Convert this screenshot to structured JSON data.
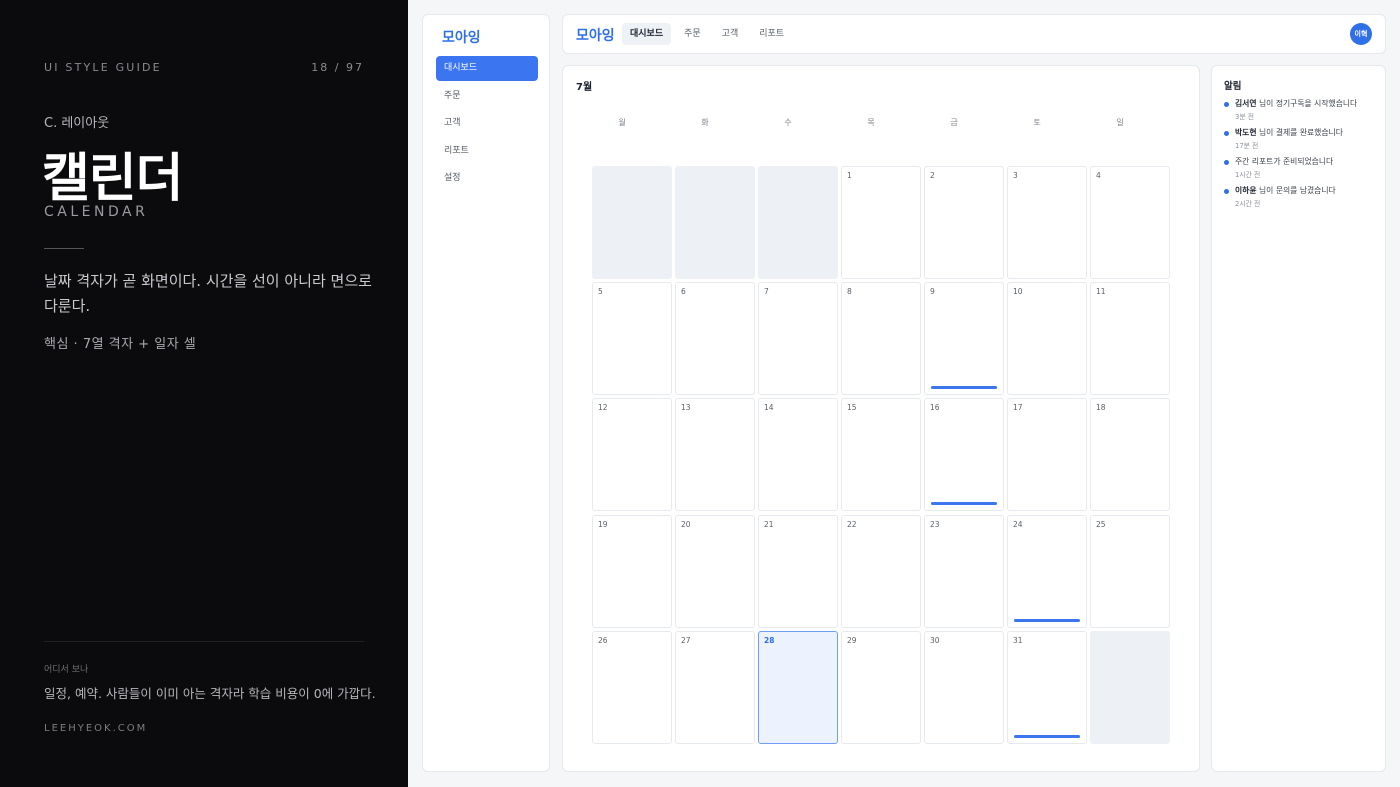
{
  "guide": {
    "header_label": "UI STYLE GUIDE",
    "page_counter": "18 / 97",
    "section": "C. 레이아웃",
    "title": "캘린더",
    "title_en": "CALENDAR",
    "description": "날짜 격자가 곧 화면이다. 시간을 선이 아니라 면으로 다룬다.",
    "core": "핵심 · 7열 격자 + 일자 셀",
    "where_label": "어디서 보나",
    "where_value": "일정, 예약. 사람들이 이미 아는 격자라 학습 비용이 0에 가깝다.",
    "site": "LEEHYEOK.COM"
  },
  "sidebar": {
    "logo": "모아잉",
    "items": [
      {
        "label": "대시보드",
        "active": true
      },
      {
        "label": "주문",
        "active": false
      },
      {
        "label": "고객",
        "active": false
      },
      {
        "label": "리포트",
        "active": false
      },
      {
        "label": "설정",
        "active": false
      }
    ]
  },
  "topbar": {
    "logo": "모아잉",
    "tabs": [
      {
        "label": "대시보드",
        "active": true
      },
      {
        "label": "주문",
        "active": false
      },
      {
        "label": "고객",
        "active": false
      },
      {
        "label": "리포트",
        "active": false
      }
    ],
    "avatar": "이혁"
  },
  "calendar": {
    "month": "7월",
    "weekdays": [
      "월",
      "화",
      "수",
      "목",
      "금",
      "토",
      "일"
    ],
    "leading_empty": 3,
    "days_in_month": 31,
    "trailing_empty": 1,
    "today": 28,
    "event_days": [
      9,
      16,
      24,
      31
    ],
    "event_color": "#3b76f0"
  },
  "notifications": {
    "title": "알림",
    "items": [
      {
        "name": "김서연",
        "text": " 님이 정기구독을 시작했습니다",
        "time": "3분 전"
      },
      {
        "name": "박도현",
        "text": " 님이 결제를 완료했습니다",
        "time": "17분 전"
      },
      {
        "name": "",
        "text": "주간 리포트가 준비되었습니다",
        "time": "1시간 전"
      },
      {
        "name": "이하윤",
        "text": " 님이 문의를 남겼습니다",
        "time": "2시간 전"
      }
    ]
  }
}
